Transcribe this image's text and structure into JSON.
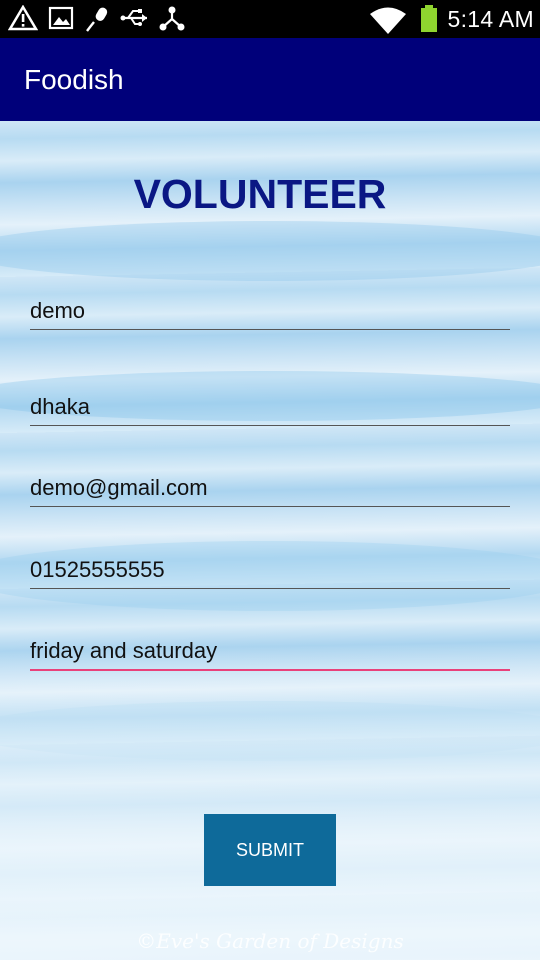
{
  "status_bar": {
    "time": "5:14 AM",
    "icons": [
      "warning-icon",
      "image-icon",
      "microphone-icon",
      "usb-icon",
      "share-icon",
      "wifi-icon",
      "battery-icon"
    ]
  },
  "app_bar": {
    "title": "Foodish"
  },
  "form": {
    "heading": "VOLUNTEER",
    "fields": [
      {
        "value": "demo"
      },
      {
        "value": "dhaka"
      },
      {
        "value": "demo@gmail.com"
      },
      {
        "value": "01525555555"
      },
      {
        "value": "friday and saturday"
      }
    ],
    "submit_label": "SUBMIT"
  },
  "background": {
    "watermark": "©Eve's Garden of Designs"
  },
  "colors": {
    "app_bar": "#00007a",
    "heading": "#0a1784",
    "submit": "#0e6a9a",
    "focus_underline": "#e9417a"
  }
}
